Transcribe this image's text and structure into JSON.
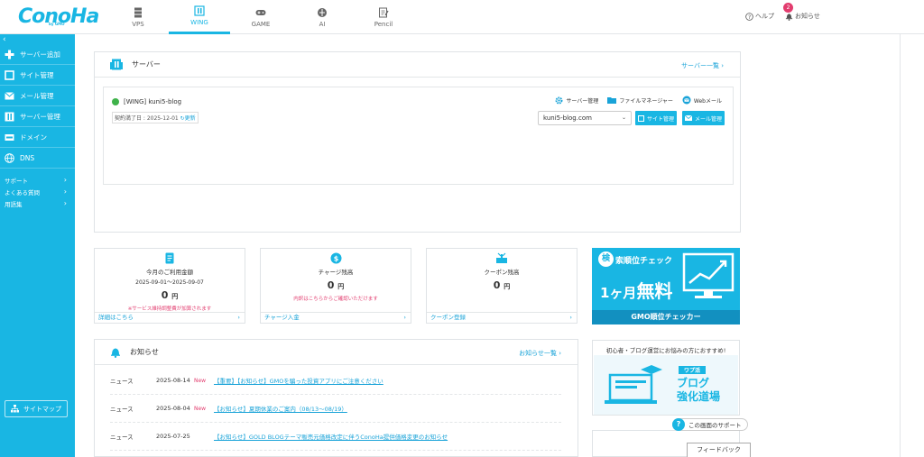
{
  "logo": {
    "text": "ConoHa",
    "sub": "by GMO"
  },
  "top_tabs": [
    {
      "label": "VPS",
      "icon": "server-stack-icon"
    },
    {
      "label": "WING",
      "icon": "wing-building-icon",
      "active": true
    },
    {
      "label": "GAME",
      "icon": "gamepad-icon"
    },
    {
      "label": "AI",
      "icon": "ai-icon"
    },
    {
      "label": "Pencil",
      "icon": "pencil-icon"
    }
  ],
  "header": {
    "help": "ヘルプ",
    "notice": "お知らせ",
    "notice_count": "2"
  },
  "sidebar": {
    "items": [
      {
        "label": "サーバー追加",
        "icon": "plus-icon"
      },
      {
        "label": "サイト管理",
        "icon": "site-icon"
      },
      {
        "label": "メール管理",
        "icon": "mail-icon"
      },
      {
        "label": "サーバー管理",
        "icon": "server-icon"
      },
      {
        "label": "ドメイン",
        "icon": "domain-icon"
      },
      {
        "label": "DNS",
        "icon": "globe-icon"
      }
    ],
    "sub_items": [
      {
        "label": "サポート"
      },
      {
        "label": "よくある質問"
      },
      {
        "label": "用語集"
      }
    ],
    "sitemap": "サイトマップ"
  },
  "server_panel": {
    "title": "サーバー",
    "list_link": "サーバー一覧",
    "server_name": "[WING] kuni5-blog",
    "contract_label": "契約満了日 : 2025-12-01",
    "renew": "更新",
    "tool_server": "サーバー管理",
    "tool_file": "ファイルマネージャー",
    "tool_webmail": "Webメール",
    "domain_selected": "kuni5-blog.com",
    "btn_site": "サイト管理",
    "btn_mail": "メール管理"
  },
  "summary": {
    "usage": {
      "title": "今月のご利用金額",
      "period": "2025-09-01～2025-09-07",
      "value": "0",
      "unit": "円",
      "note": "※サービス維持調整費が加算されます",
      "link": "詳細はこちら"
    },
    "charge": {
      "title": "チャージ残高",
      "value": "0",
      "unit": "円",
      "note": "内訳はこちらからご確認いただけます",
      "link": "チャージ入金"
    },
    "coupon": {
      "title": "クーポン残高",
      "value": "0",
      "unit": "円",
      "link": "クーポン登録"
    }
  },
  "banners": {
    "rank_check": {
      "kanji": "検",
      "title": "索順位チェック",
      "big_a": "1ヶ月",
      "big_b": "無料",
      "foot": "GMO順位チェッカー"
    },
    "blog_dojo": {
      "head": "初心者・ブログ運営にお悩みの方におすすめ!",
      "tag": "ワプ活",
      "line1": "ブログ",
      "line2": "強化道場"
    }
  },
  "notice_panel": {
    "title": "お知らせ",
    "list_link": "お知らせ一覧",
    "rows": [
      {
        "category": "ニュース",
        "date": "2025-08-14",
        "new": "New",
        "title": "【重要】【お知らせ】GMOを騙った投資アプリにご注意ください"
      },
      {
        "category": "ニュース",
        "date": "2025-08-04",
        "new": "New",
        "title": "【お知らせ】夏期休業のご案内（08/13～08/19）"
      },
      {
        "category": "ニュース",
        "date": "2025-07-25",
        "new": "",
        "title": "【お知らせ】GOLD BLOGテーマ販売元価格改定に伴うConoHa提供価格変更のお知らせ"
      }
    ]
  },
  "support_button": "この画面のサポート",
  "feedback_button": "フィードバック",
  "colors": {
    "brand": "#19b6e3",
    "accent_red": "#e23c6e",
    "link": "#19a3d8"
  }
}
